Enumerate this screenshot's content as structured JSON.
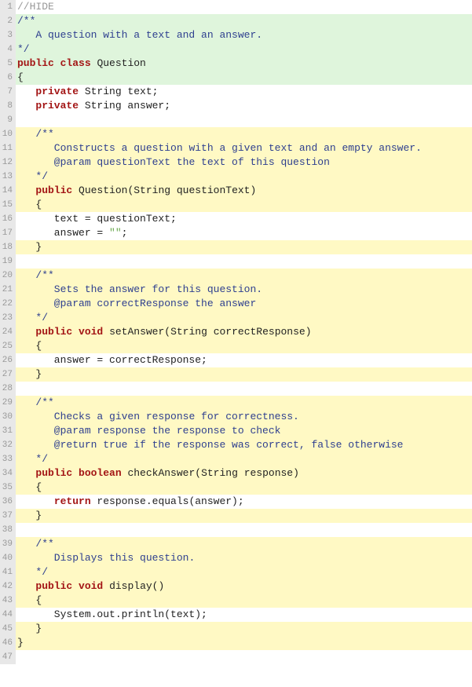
{
  "lines": [
    {
      "num": 1,
      "hl": "none",
      "tokens": [
        {
          "cls": "comment",
          "t": "//HIDE"
        }
      ]
    },
    {
      "num": 2,
      "hl": "green",
      "tokens": [
        {
          "cls": "doc-comment",
          "t": "/**"
        }
      ]
    },
    {
      "num": 3,
      "hl": "green",
      "tokens": [
        {
          "cls": "doc-comment",
          "t": "   A question with a text and an answer."
        }
      ]
    },
    {
      "num": 4,
      "hl": "green",
      "tokens": [
        {
          "cls": "doc-comment",
          "t": "*/"
        }
      ]
    },
    {
      "num": 5,
      "hl": "green",
      "tokens": [
        {
          "cls": "keyword",
          "t": "public"
        },
        {
          "cls": "plain",
          "t": " "
        },
        {
          "cls": "keyword",
          "t": "class"
        },
        {
          "cls": "plain",
          "t": " "
        },
        {
          "cls": "classname",
          "t": "Question"
        }
      ]
    },
    {
      "num": 6,
      "hl": "green",
      "tokens": [
        {
          "cls": "brace",
          "t": "{"
        }
      ]
    },
    {
      "num": 7,
      "hl": "none",
      "tokens": [
        {
          "cls": "plain",
          "t": "   "
        },
        {
          "cls": "keyword",
          "t": "private"
        },
        {
          "cls": "plain",
          "t": " String text;"
        }
      ]
    },
    {
      "num": 8,
      "hl": "none",
      "tokens": [
        {
          "cls": "plain",
          "t": "   "
        },
        {
          "cls": "keyword",
          "t": "private"
        },
        {
          "cls": "plain",
          "t": " String answer;"
        }
      ]
    },
    {
      "num": 9,
      "hl": "none",
      "tokens": []
    },
    {
      "num": 10,
      "hl": "yellow",
      "tokens": [
        {
          "cls": "plain",
          "t": "   "
        },
        {
          "cls": "doc-comment",
          "t": "/**"
        }
      ]
    },
    {
      "num": 11,
      "hl": "yellow",
      "tokens": [
        {
          "cls": "plain",
          "t": "   "
        },
        {
          "cls": "doc-comment",
          "t": "   Constructs a question with a given text and an empty answer."
        }
      ]
    },
    {
      "num": 12,
      "hl": "yellow",
      "tokens": [
        {
          "cls": "plain",
          "t": "   "
        },
        {
          "cls": "doc-comment",
          "t": "   @param questionText the text of this question"
        }
      ]
    },
    {
      "num": 13,
      "hl": "yellow",
      "tokens": [
        {
          "cls": "plain",
          "t": "   "
        },
        {
          "cls": "doc-comment",
          "t": "*/"
        }
      ]
    },
    {
      "num": 14,
      "hl": "yellow",
      "tokens": [
        {
          "cls": "plain",
          "t": "   "
        },
        {
          "cls": "keyword",
          "t": "public"
        },
        {
          "cls": "plain",
          "t": " "
        },
        {
          "cls": "method",
          "t": "Question"
        },
        {
          "cls": "plain",
          "t": "(String questionText)"
        }
      ]
    },
    {
      "num": 15,
      "hl": "yellow",
      "tokens": [
        {
          "cls": "plain",
          "t": "   "
        },
        {
          "cls": "brace",
          "t": "{"
        }
      ]
    },
    {
      "num": 16,
      "hl": "none",
      "tokens": [
        {
          "cls": "plain",
          "t": "      text = questionText;"
        }
      ]
    },
    {
      "num": 17,
      "hl": "none",
      "tokens": [
        {
          "cls": "plain",
          "t": "      answer = "
        },
        {
          "cls": "string",
          "t": "\"\""
        },
        {
          "cls": "plain",
          "t": ";"
        }
      ]
    },
    {
      "num": 18,
      "hl": "yellow",
      "tokens": [
        {
          "cls": "plain",
          "t": "   "
        },
        {
          "cls": "brace",
          "t": "}"
        }
      ]
    },
    {
      "num": 19,
      "hl": "none",
      "tokens": []
    },
    {
      "num": 20,
      "hl": "yellow",
      "tokens": [
        {
          "cls": "plain",
          "t": "   "
        },
        {
          "cls": "doc-comment",
          "t": "/**"
        }
      ]
    },
    {
      "num": 21,
      "hl": "yellow",
      "tokens": [
        {
          "cls": "plain",
          "t": "   "
        },
        {
          "cls": "doc-comment",
          "t": "   Sets the answer for this question."
        }
      ]
    },
    {
      "num": 22,
      "hl": "yellow",
      "tokens": [
        {
          "cls": "plain",
          "t": "   "
        },
        {
          "cls": "doc-comment",
          "t": "   @param correctResponse the answer"
        }
      ]
    },
    {
      "num": 23,
      "hl": "yellow",
      "tokens": [
        {
          "cls": "plain",
          "t": "   "
        },
        {
          "cls": "doc-comment",
          "t": "*/"
        }
      ]
    },
    {
      "num": 24,
      "hl": "yellow",
      "tokens": [
        {
          "cls": "plain",
          "t": "   "
        },
        {
          "cls": "keyword",
          "t": "public"
        },
        {
          "cls": "plain",
          "t": " "
        },
        {
          "cls": "keyword",
          "t": "void"
        },
        {
          "cls": "plain",
          "t": " "
        },
        {
          "cls": "method",
          "t": "setAnswer"
        },
        {
          "cls": "plain",
          "t": "(String correctResponse)"
        }
      ]
    },
    {
      "num": 25,
      "hl": "yellow",
      "tokens": [
        {
          "cls": "plain",
          "t": "   "
        },
        {
          "cls": "brace",
          "t": "{"
        }
      ]
    },
    {
      "num": 26,
      "hl": "none",
      "tokens": [
        {
          "cls": "plain",
          "t": "      answer = correctResponse;"
        }
      ]
    },
    {
      "num": 27,
      "hl": "yellow",
      "tokens": [
        {
          "cls": "plain",
          "t": "   "
        },
        {
          "cls": "brace",
          "t": "}"
        }
      ]
    },
    {
      "num": 28,
      "hl": "none",
      "tokens": []
    },
    {
      "num": 29,
      "hl": "yellow",
      "tokens": [
        {
          "cls": "plain",
          "t": "   "
        },
        {
          "cls": "doc-comment",
          "t": "/**"
        }
      ]
    },
    {
      "num": 30,
      "hl": "yellow",
      "tokens": [
        {
          "cls": "plain",
          "t": "   "
        },
        {
          "cls": "doc-comment",
          "t": "   Checks a given response for correctness."
        }
      ]
    },
    {
      "num": 31,
      "hl": "yellow",
      "tokens": [
        {
          "cls": "plain",
          "t": "   "
        },
        {
          "cls": "doc-comment",
          "t": "   @param response the response to check"
        }
      ]
    },
    {
      "num": 32,
      "hl": "yellow",
      "tokens": [
        {
          "cls": "plain",
          "t": "   "
        },
        {
          "cls": "doc-comment",
          "t": "   @return true if the response was correct, false otherwise"
        }
      ]
    },
    {
      "num": 33,
      "hl": "yellow",
      "tokens": [
        {
          "cls": "plain",
          "t": "   "
        },
        {
          "cls": "doc-comment",
          "t": "*/"
        }
      ]
    },
    {
      "num": 34,
      "hl": "yellow",
      "tokens": [
        {
          "cls": "plain",
          "t": "   "
        },
        {
          "cls": "keyword",
          "t": "public"
        },
        {
          "cls": "plain",
          "t": " "
        },
        {
          "cls": "keyword",
          "t": "boolean"
        },
        {
          "cls": "plain",
          "t": " "
        },
        {
          "cls": "method",
          "t": "checkAnswer"
        },
        {
          "cls": "plain",
          "t": "(String response)"
        }
      ]
    },
    {
      "num": 35,
      "hl": "yellow",
      "tokens": [
        {
          "cls": "plain",
          "t": "   "
        },
        {
          "cls": "brace",
          "t": "{"
        }
      ]
    },
    {
      "num": 36,
      "hl": "none",
      "tokens": [
        {
          "cls": "plain",
          "t": "      "
        },
        {
          "cls": "keyword",
          "t": "return"
        },
        {
          "cls": "plain",
          "t": " response.equals(answer);"
        }
      ]
    },
    {
      "num": 37,
      "hl": "yellow",
      "tokens": [
        {
          "cls": "plain",
          "t": "   "
        },
        {
          "cls": "brace",
          "t": "}"
        }
      ]
    },
    {
      "num": 38,
      "hl": "none",
      "tokens": []
    },
    {
      "num": 39,
      "hl": "yellow",
      "tokens": [
        {
          "cls": "plain",
          "t": "   "
        },
        {
          "cls": "doc-comment",
          "t": "/**"
        }
      ]
    },
    {
      "num": 40,
      "hl": "yellow",
      "tokens": [
        {
          "cls": "plain",
          "t": "   "
        },
        {
          "cls": "doc-comment",
          "t": "   Displays this question."
        }
      ]
    },
    {
      "num": 41,
      "hl": "yellow",
      "tokens": [
        {
          "cls": "plain",
          "t": "   "
        },
        {
          "cls": "doc-comment",
          "t": "*/"
        }
      ]
    },
    {
      "num": 42,
      "hl": "yellow",
      "tokens": [
        {
          "cls": "plain",
          "t": "   "
        },
        {
          "cls": "keyword",
          "t": "public"
        },
        {
          "cls": "plain",
          "t": " "
        },
        {
          "cls": "keyword",
          "t": "void"
        },
        {
          "cls": "plain",
          "t": " "
        },
        {
          "cls": "method",
          "t": "display"
        },
        {
          "cls": "plain",
          "t": "()"
        }
      ]
    },
    {
      "num": 43,
      "hl": "yellow",
      "tokens": [
        {
          "cls": "plain",
          "t": "   "
        },
        {
          "cls": "brace",
          "t": "{"
        }
      ]
    },
    {
      "num": 44,
      "hl": "none",
      "tokens": [
        {
          "cls": "plain",
          "t": "      System.out.println(text);"
        }
      ]
    },
    {
      "num": 45,
      "hl": "yellow",
      "tokens": [
        {
          "cls": "plain",
          "t": "   "
        },
        {
          "cls": "brace",
          "t": "}"
        }
      ]
    },
    {
      "num": 46,
      "hl": "yellow",
      "tokens": [
        {
          "cls": "brace",
          "t": "}"
        }
      ]
    },
    {
      "num": 47,
      "hl": "none",
      "tokens": []
    }
  ]
}
